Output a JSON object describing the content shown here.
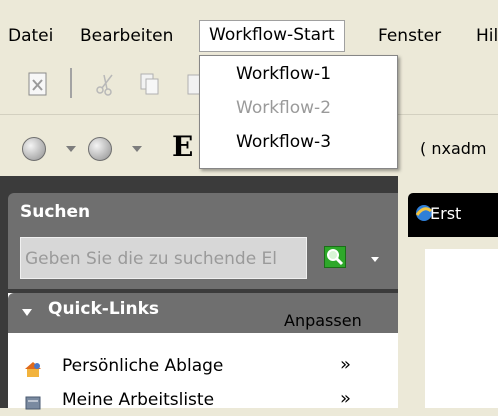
{
  "menubar": {
    "items": [
      "Datei",
      "Bearbeiten",
      "Workflow-Start",
      "Fenster",
      "Hil"
    ]
  },
  "workflow_menu": {
    "items": [
      {
        "label": "Workflow-1",
        "enabled": true
      },
      {
        "label": "Workflow-2",
        "enabled": false
      },
      {
        "label": "Workflow-3",
        "enabled": true
      }
    ]
  },
  "titlebar": {
    "title_fragment": "E",
    "user": "( nxadm"
  },
  "search": {
    "title": "Suchen",
    "placeholder": "Geben Sie die zu suchende El"
  },
  "quicklinks": {
    "title": "Quick-Links",
    "customize": "Anpassen",
    "items": [
      {
        "label": "Persönliche Ablage",
        "icon": "personal-folder-icon",
        "chevron": "»"
      },
      {
        "label": "Meine Arbeitsliste",
        "icon": "worklist-icon",
        "chevron": "»"
      }
    ]
  },
  "right_tab": {
    "label": "Erst"
  },
  "colors": {
    "panel_dark": "#3b3b3b",
    "section_gray": "#6f6f6f",
    "search_green": "#2ea82a",
    "chrome": "#ece9d8"
  }
}
